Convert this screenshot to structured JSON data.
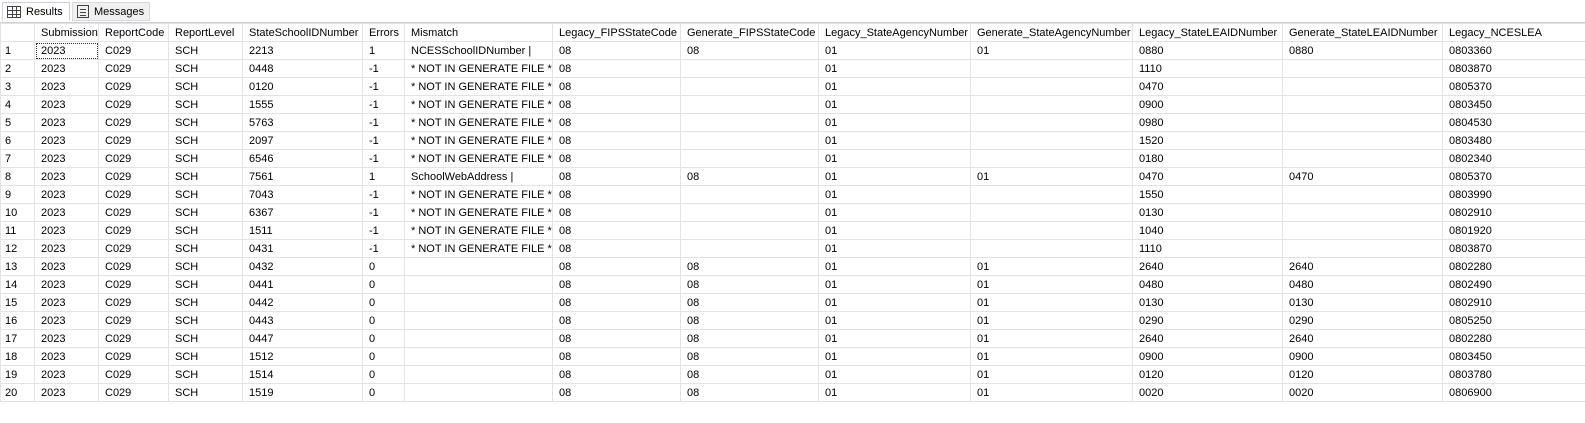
{
  "tabs": [
    {
      "label": "Results",
      "icon": "grid-results-icon"
    },
    {
      "label": "Messages",
      "icon": "messages-icon"
    }
  ],
  "columns": [
    "SubmissionYear",
    "ReportCode",
    "ReportLevel",
    "StateSchoolIDNumber",
    "Errors",
    "Mismatch",
    "Legacy_FIPSStateCode",
    "Generate_FIPSStateCode",
    "Legacy_StateAgencyNumber",
    "Generate_StateAgencyNumber",
    "Legacy_StateLEAIDNumber",
    "Generate_StateLEAIDNumber",
    "Legacy_NCESLEA"
  ],
  "rows": [
    [
      "1",
      "2023",
      "C029",
      "SCH",
      "2213",
      "1",
      "NCESSchoolIDNumber |",
      "08",
      "08",
      "01",
      "01",
      "0880",
      "0880",
      "0803360"
    ],
    [
      "2",
      "2023",
      "C029",
      "SCH",
      "0448",
      "-1",
      "* NOT IN GENERATE FILE *",
      "08",
      "",
      "01",
      "",
      "1110",
      "",
      "0803870"
    ],
    [
      "3",
      "2023",
      "C029",
      "SCH",
      "0120",
      "-1",
      "* NOT IN GENERATE FILE *",
      "08",
      "",
      "01",
      "",
      "0470",
      "",
      "0805370"
    ],
    [
      "4",
      "2023",
      "C029",
      "SCH",
      "1555",
      "-1",
      "* NOT IN GENERATE FILE *",
      "08",
      "",
      "01",
      "",
      "0900",
      "",
      "0803450"
    ],
    [
      "5",
      "2023",
      "C029",
      "SCH",
      "5763",
      "-1",
      "* NOT IN GENERATE FILE *",
      "08",
      "",
      "01",
      "",
      "0980",
      "",
      "0804530"
    ],
    [
      "6",
      "2023",
      "C029",
      "SCH",
      "2097",
      "-1",
      "* NOT IN GENERATE FILE *",
      "08",
      "",
      "01",
      "",
      "1520",
      "",
      "0803480"
    ],
    [
      "7",
      "2023",
      "C029",
      "SCH",
      "6546",
      "-1",
      "* NOT IN GENERATE FILE *",
      "08",
      "",
      "01",
      "",
      "0180",
      "",
      "0802340"
    ],
    [
      "8",
      "2023",
      "C029",
      "SCH",
      "7561",
      "1",
      "SchoolWebAddress |",
      "08",
      "08",
      "01",
      "01",
      "0470",
      "0470",
      "0805370"
    ],
    [
      "9",
      "2023",
      "C029",
      "SCH",
      "7043",
      "-1",
      "* NOT IN GENERATE FILE *",
      "08",
      "",
      "01",
      "",
      "1550",
      "",
      "0803990"
    ],
    [
      "10",
      "2023",
      "C029",
      "SCH",
      "6367",
      "-1",
      "* NOT IN GENERATE FILE *",
      "08",
      "",
      "01",
      "",
      "0130",
      "",
      "0802910"
    ],
    [
      "11",
      "2023",
      "C029",
      "SCH",
      "1511",
      "-1",
      "* NOT IN GENERATE FILE *",
      "08",
      "",
      "01",
      "",
      "1040",
      "",
      "0801920"
    ],
    [
      "12",
      "2023",
      "C029",
      "SCH",
      "0431",
      "-1",
      "* NOT IN GENERATE FILE *",
      "08",
      "",
      "01",
      "",
      "1110",
      "",
      "0803870"
    ],
    [
      "13",
      "2023",
      "C029",
      "SCH",
      "0432",
      "0",
      "",
      "08",
      "08",
      "01",
      "01",
      "2640",
      "2640",
      "0802280"
    ],
    [
      "14",
      "2023",
      "C029",
      "SCH",
      "0441",
      "0",
      "",
      "08",
      "08",
      "01",
      "01",
      "0480",
      "0480",
      "0802490"
    ],
    [
      "15",
      "2023",
      "C029",
      "SCH",
      "0442",
      "0",
      "",
      "08",
      "08",
      "01",
      "01",
      "0130",
      "0130",
      "0802910"
    ],
    [
      "16",
      "2023",
      "C029",
      "SCH",
      "0443",
      "0",
      "",
      "08",
      "08",
      "01",
      "01",
      "0290",
      "0290",
      "0805250"
    ],
    [
      "17",
      "2023",
      "C029",
      "SCH",
      "0447",
      "0",
      "",
      "08",
      "08",
      "01",
      "01",
      "2640",
      "2640",
      "0802280"
    ],
    [
      "18",
      "2023",
      "C029",
      "SCH",
      "1512",
      "0",
      "",
      "08",
      "08",
      "01",
      "01",
      "0900",
      "0900",
      "0803450"
    ],
    [
      "19",
      "2023",
      "C029",
      "SCH",
      "1514",
      "0",
      "",
      "08",
      "08",
      "01",
      "01",
      "0120",
      "0120",
      "0803780"
    ],
    [
      "20",
      "2023",
      "C029",
      "SCH",
      "1519",
      "0",
      "",
      "08",
      "08",
      "01",
      "01",
      "0020",
      "0020",
      "0806900"
    ]
  ]
}
